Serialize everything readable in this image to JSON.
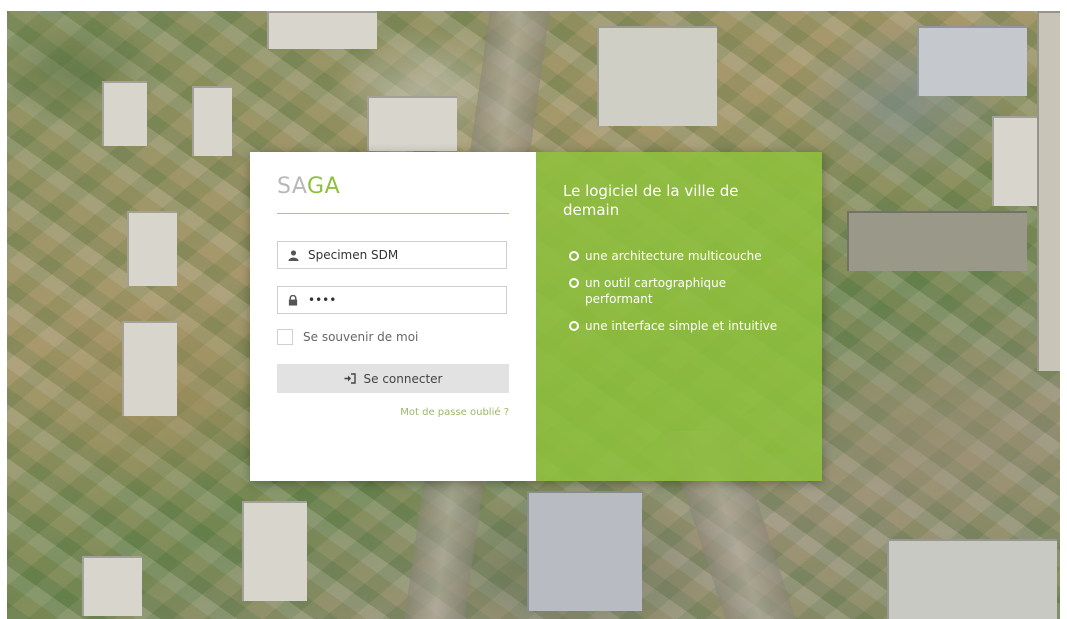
{
  "brand": {
    "part1": "SA",
    "part2": "GA",
    "accent_color": "#8ec03c"
  },
  "login": {
    "username_value": "Specimen SDM",
    "password_value": "••••",
    "remember_label": "Se souvenir de moi",
    "submit_label": "Se connecter",
    "forgot_label": "Mot de passe oublié ?"
  },
  "promo": {
    "title": "Le logiciel de la ville de demain",
    "features": [
      "une architecture multicouche",
      "un outil cartographique performant",
      "une interface simple et intuitive"
    ],
    "background_color": "#8ec03c"
  },
  "icons": {
    "user": "user-icon",
    "lock": "lock-icon",
    "sign_in": "sign-in-icon",
    "feature_bullet": "circle-outline-icon"
  }
}
